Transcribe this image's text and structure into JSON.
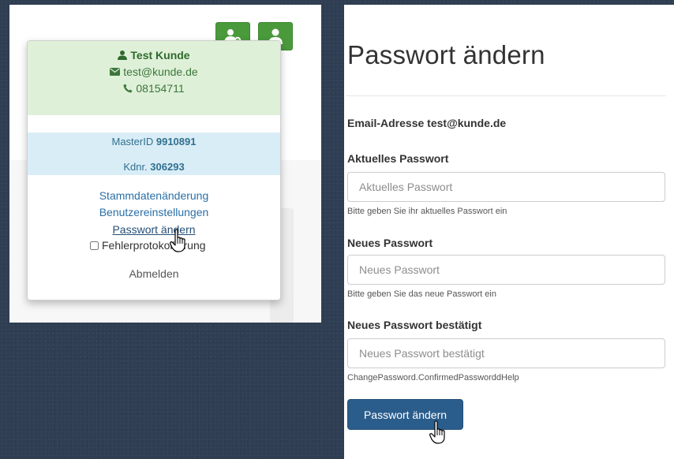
{
  "colors": {
    "background": "#2f3e52",
    "green_button": "#4a9a3c",
    "user_box": "#dff0d8",
    "id_box": "#d9edf7",
    "link": "#2a6fa8",
    "primary_button": "#2b5d8c"
  },
  "header_buttons": [
    {
      "icon": "user-cog-icon"
    },
    {
      "icon": "user-icon"
    }
  ],
  "user_menu": {
    "name": "Test Kunde",
    "email": "test@kunde.de",
    "phone": "08154711",
    "master_id_label": "MasterID",
    "master_id_value": "9910891",
    "customer_no_label": "Kdnr.",
    "customer_no_value": "306293",
    "links": {
      "master_data": "Stammdatenänderung",
      "user_settings": "Benutzereinstellungen",
      "change_password": "Passwort ändern"
    },
    "error_logging": {
      "label": "Fehlerprotokollierung",
      "checked": false
    },
    "logout": "Abmelden"
  },
  "change_password_form": {
    "title": "Passwort ändern",
    "email_label": "Email-Adresse",
    "email_value": "test@kunde.de",
    "current": {
      "label": "Aktuelles Passwort",
      "placeholder": "Aktuelles Passwort",
      "help": "Bitte geben Sie ihr aktuelles Passwort ein"
    },
    "new": {
      "label": "Neues Passwort",
      "placeholder": "Neues Passwort",
      "help": "Bitte geben Sie das neue Passwort ein"
    },
    "confirm": {
      "label": "Neues Passwort bestätigt",
      "placeholder": "Neues Passwort bestätigt",
      "help": "ChangePassword.ConfirmedPassworddHelp"
    },
    "submit_label": "Passwort ändern"
  }
}
